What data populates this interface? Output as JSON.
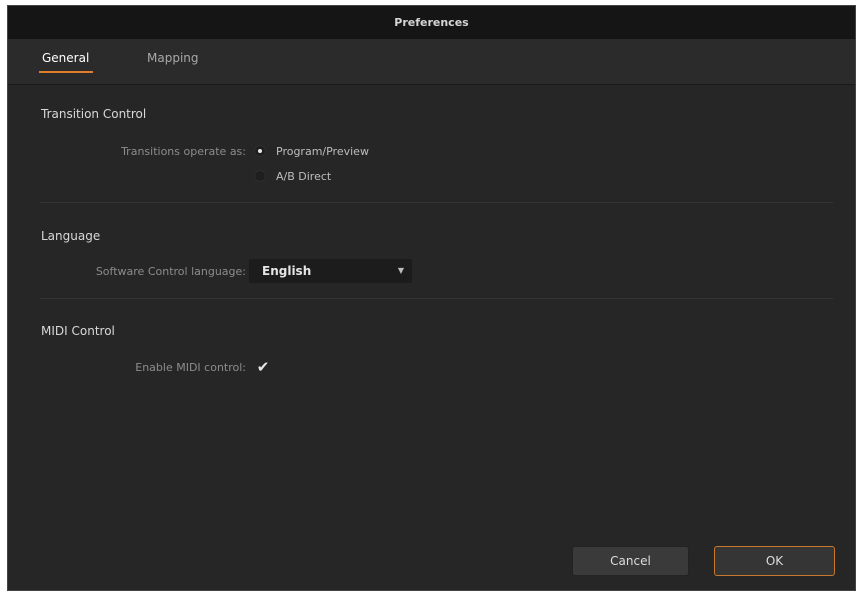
{
  "window": {
    "title": "Preferences"
  },
  "tabs": [
    {
      "label": "General",
      "active": true
    },
    {
      "label": "Mapping",
      "active": false
    }
  ],
  "transition": {
    "section_title": "Transition Control",
    "field_label": "Transitions operate as:",
    "options": [
      {
        "label": "Program/Preview",
        "selected": true
      },
      {
        "label": "A/B Direct",
        "selected": false
      }
    ]
  },
  "language": {
    "section_title": "Language",
    "field_label": "Software Control language:",
    "selected": "English"
  },
  "midi": {
    "section_title": "MIDI Control",
    "field_label": "Enable MIDI control:",
    "enabled": true
  },
  "buttons": {
    "cancel": "Cancel",
    "ok": "OK"
  },
  "colors": {
    "accent": "#e07d2a",
    "background": "#262626",
    "titlebar": "#151515"
  },
  "icons": {
    "dropdown_arrow": "chevron-down-icon",
    "checkmark": "checkmark-icon"
  }
}
